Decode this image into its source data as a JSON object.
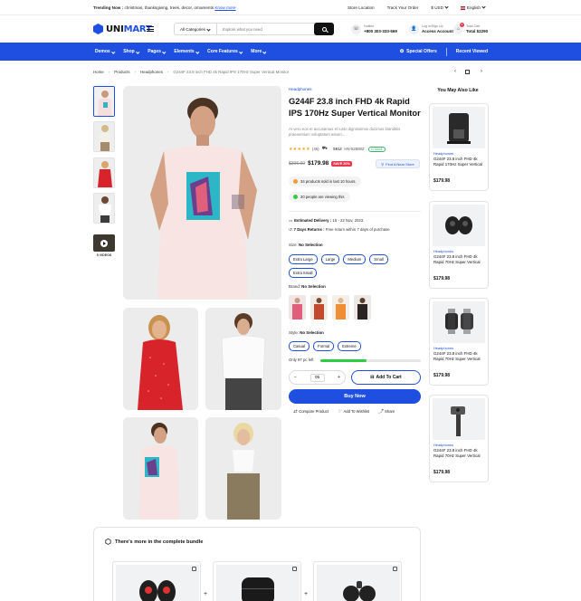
{
  "topbar": {
    "trending_label": "Trending Now :",
    "trending_terms": "christmas, thanksgiving, trees, decor, ornaments",
    "know_more": "Know more",
    "store_location": "Store Location",
    "track_order": "Track Your Order",
    "currency": "$ USD",
    "language": "English"
  },
  "header": {
    "logo_main": "UNI",
    "logo_accent": "MART",
    "category_select": "All Categories",
    "search_placeholder": "Explore what you need",
    "hotline_label": "Hotline",
    "hotline_number": "+800 303-333-569",
    "account_label": "Log in/Sign Up",
    "account_value": "Access Account",
    "cart_label": "Total Cart",
    "cart_total": "Total $2290",
    "cart_count": "3"
  },
  "nav": {
    "items": [
      "Demos",
      "Shop",
      "Pages",
      "Elements",
      "Core Features",
      "More"
    ],
    "special_offers": "Special Offers",
    "recent_viewed": "Recent Viewed"
  },
  "breadcrumb": {
    "items": [
      "Home",
      "Products",
      "Headphones"
    ],
    "current": "G244F 23.8 inch FHD 4k Rapid IPS 170Hz Super Vertical Monitor"
  },
  "gallery": {
    "videos_label": "5 VIDEOS"
  },
  "product": {
    "category": "Headphones",
    "title": "G244F 23.8 inch FHD 4k Rapid IPS 170Hz Super Vertical Monitor",
    "description": "At vero eos et accusamus et iusto dignissimos ducimus blanditiis praesentium voluptatum atsum...",
    "stars": "★★★★★",
    "rating_count": "(46)",
    "sku_label": "SKU:",
    "sku": "HN-52880Z",
    "in_stock": "In Stock",
    "old_price": "$395.00",
    "price": "$179.98",
    "save": "SAVE 20%",
    "find_store": "Find A Near Store",
    "sold_text": "34 products sold in last 10 hours.",
    "viewing_text": "20 people are viewing this",
    "delivery_label": "Estimated Delivery :",
    "delivery_value": "15 - 22 Nov, 2023",
    "returns_label": "7 Days Returns :",
    "returns_value": "Free return within 7 days of purchase",
    "size_label": "Size:",
    "size_value": "No Selection",
    "sizes": [
      "Extra Large",
      "Large",
      "Medium",
      "Small",
      "Extra Small"
    ],
    "brand_label": "Brand:",
    "brand_value": "No Selection",
    "style_label": "Style:",
    "style_value": "No Selection",
    "styles": [
      "Casual",
      "Formal",
      "Extreme"
    ],
    "stock_text": "Only 97 pc left",
    "stock_fraction": 0.46,
    "quantity": "05",
    "minus": "−",
    "plus": "+",
    "add_to_cart": "Add To Cart",
    "buy_now": "Buy Now",
    "compare": "Compare Product",
    "wishlist": "Add To Wishlist",
    "share": "Share"
  },
  "related": {
    "title": "You May Also Like",
    "items": [
      {
        "category": "Headphones",
        "name": "G244F 23.8 inch FHD 4k Rapid 170Hz Super Vertical",
        "price": "$179.98"
      },
      {
        "category": "Headphones",
        "name": "G244F 23.8 inch FHD 4k Rapid 70Hz Super Vertical",
        "price": "$179.98"
      },
      {
        "category": "Headphones",
        "name": "G244F 23.8 inch FHD 4k Rapid 70Hz Super Vertical",
        "price": "$179.98"
      },
      {
        "category": "Headphones",
        "name": "G244F 23.8 inch FHD 4k Rapid 70Hz Super Vertical",
        "price": "$179.98"
      }
    ]
  },
  "bundle": {
    "title": "There's more in the complete bundle"
  },
  "colors": {
    "accent": "#1f4fe0",
    "sale": "#e8384f",
    "stock_green": "#2ecc40",
    "star": "#f5a623"
  }
}
